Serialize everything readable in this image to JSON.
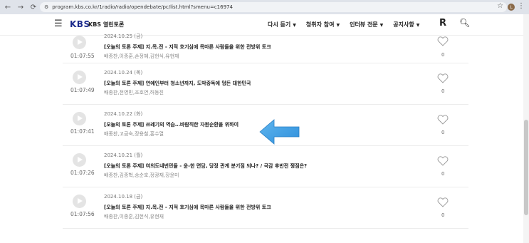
{
  "browser": {
    "url": "program.kbs.co.kr/1radio/radio/opendebate/pc/list.html?smenu=c16974",
    "profile_initial": "L"
  },
  "header": {
    "logo": "KBS",
    "brand": "KBS 열린토론",
    "menu": [
      {
        "label": "다시 듣기"
      },
      {
        "label": "청취자 참여"
      },
      {
        "label": "인터뷰 전문"
      },
      {
        "label": "공지사항"
      }
    ]
  },
  "episodes": [
    {
      "date": "2024.10.25 (금)",
      "title": "[오늘의 토론 주제] 지.목.전 - 지적 호기심에 목마른 사람들을 위한 전방위 토크",
      "guests": "배종찬,이종훈,손정혜,김헌식,유현재",
      "duration": "01:07:55",
      "likes": "0"
    },
    {
      "date": "2024.10.24 (목)",
      "title": "[오늘의 토론 주제] 연예인부터 청소년까지, 도박중독에 멍든 대한민국",
      "guests": "배종찬,전영민,조호연,허동진",
      "duration": "01:07:49",
      "likes": "0"
    },
    {
      "date": "2024.10.22 (화)",
      "title": "[오늘의 토론 주제] 쓰레기의 역습…바람직한 자원순환을 위하여",
      "guests": "배종찬,고금숙,장용철,홍수열",
      "duration": "01:07:41",
      "likes": "0"
    },
    {
      "date": "2024.10.21 (월)",
      "title": "[오늘의 토론 주제] 여의도네번민들 - 윤-한 면담, 당정 관계 분기점 되나? / 국감 후반전 쟁점은?",
      "guests": "배종찬,김종혁,송순호,정광재,장윤미",
      "duration": "01:07:26",
      "likes": "0"
    },
    {
      "date": "2024.10.18 (금)",
      "title": "[오늘의 토론 주제] 지.목.전 - 지적 호기심에 목마른 사람들을 위한 전방위 토크",
      "guests": "배종찬,이종훈,김헌식,유현재",
      "duration": "01:07:56",
      "likes": "0"
    }
  ]
}
